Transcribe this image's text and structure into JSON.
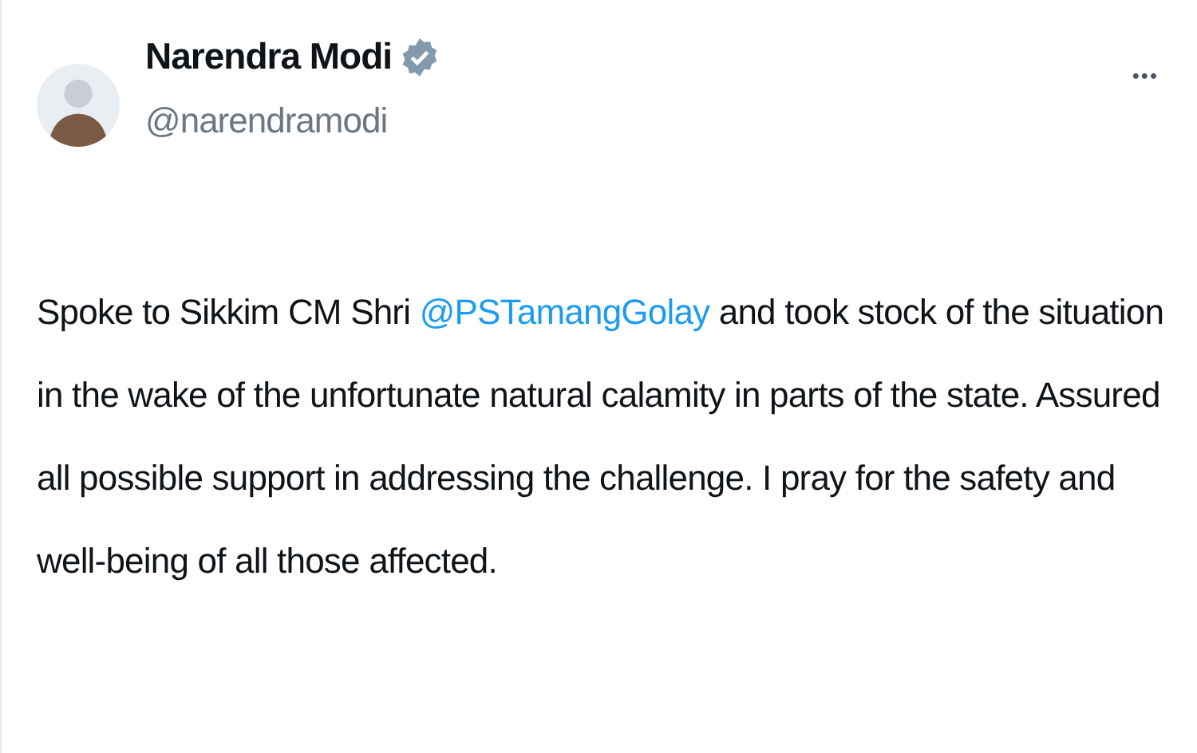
{
  "tweet": {
    "author": {
      "name": "Narendra Modi",
      "verified": true,
      "handle": "@narendramodi"
    },
    "more_menu": "•••",
    "text": [
      {
        "kind": "plain",
        "text": "Spoke to Sikkim CM Shri "
      },
      {
        "kind": "mention",
        "text": "@PSTamangGolay"
      },
      {
        "kind": "plain",
        "text": " and took stock of the situation in the wake of the unfortunate natural calamity in parts of the state. Assured all possible support in addressing the challenge. I pray for the safety and well-being of all those affected."
      }
    ]
  }
}
